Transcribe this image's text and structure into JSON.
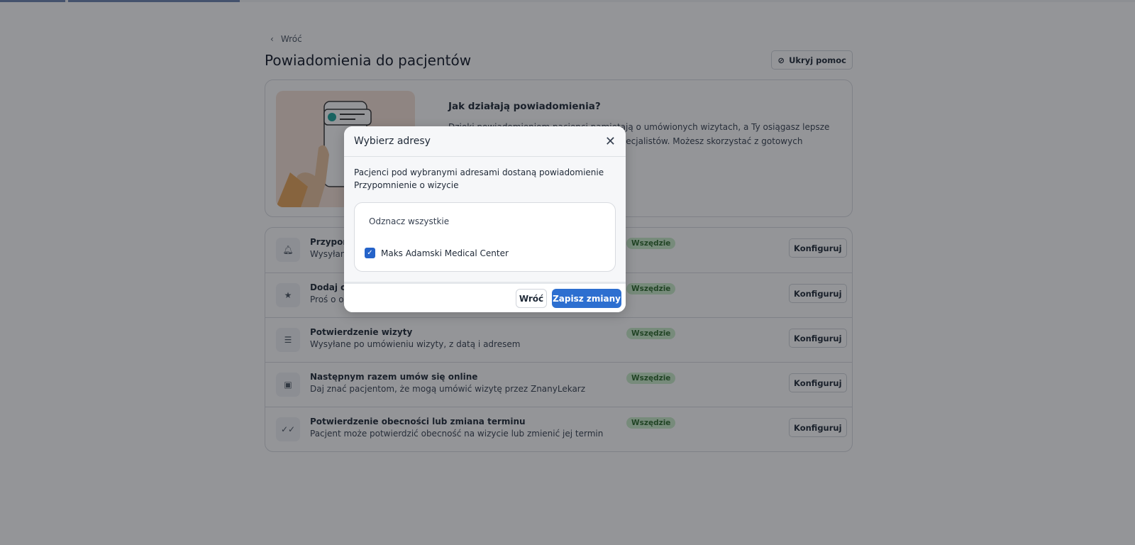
{
  "page": {
    "back_label": "Wróć",
    "title": "Powiadomienia do pacjentów",
    "hide_help_label": "Ukryj pomoc"
  },
  "help": {
    "title": "Jak działają powiadomienia?",
    "line1": "Dzięki powiadomieniom pacjenci pamiętają o umówionych wizytach, a Ty osiągasz lepsze",
    "line2": "h specjalistów. Możesz skorzystać z gotowych"
  },
  "notifications": [
    {
      "icon": "bell-icon",
      "title": "Przypom",
      "description": "Wysyłan",
      "badge": "Wszędzie",
      "button": "Konfiguruj"
    },
    {
      "icon": "star-icon",
      "title": "Dodaj op",
      "description": "Proś o op",
      "badge": "Wszędzie",
      "button": "Konfiguruj"
    },
    {
      "icon": "list-icon",
      "title": "Potwierdzenie wizyty",
      "description": "Wysyłane po umówieniu wizyty, z datą i adresem",
      "badge": "Wszędzie",
      "button": "Konfiguruj"
    },
    {
      "icon": "calendar-check-icon",
      "title": "Następnym razem umów się online",
      "description": "Daj znać pacjentom, że mogą umówić wizytę przez ZnanyLekarz",
      "badge": "Wszędzie",
      "button": "Konfiguruj"
    },
    {
      "icon": "double-check-icon",
      "title": "Potwierdzenie obecności lub zmiana terminu",
      "description": "Pacjent może potwierdzić obecność na wizycie lub zmienić jej termin",
      "badge": "Wszędzie",
      "button": "Konfiguruj"
    }
  ],
  "modal": {
    "title": "Wybierz adresy",
    "description": "Pacjenci pod wybranymi adresami dostaną powiadomienie Przypomnienie o wizycie",
    "unselect_all": "Odznacz wszystkie",
    "addresses": [
      {
        "label": "Maks Adamski Medical Center",
        "checked": true
      }
    ],
    "back_label": "Wróć",
    "save_label": "Zapisz zmiany"
  },
  "colors": {
    "primary": "#2d6fd0",
    "badge_bg": "#c9ecc9",
    "badge_text": "#2c6a2c"
  }
}
